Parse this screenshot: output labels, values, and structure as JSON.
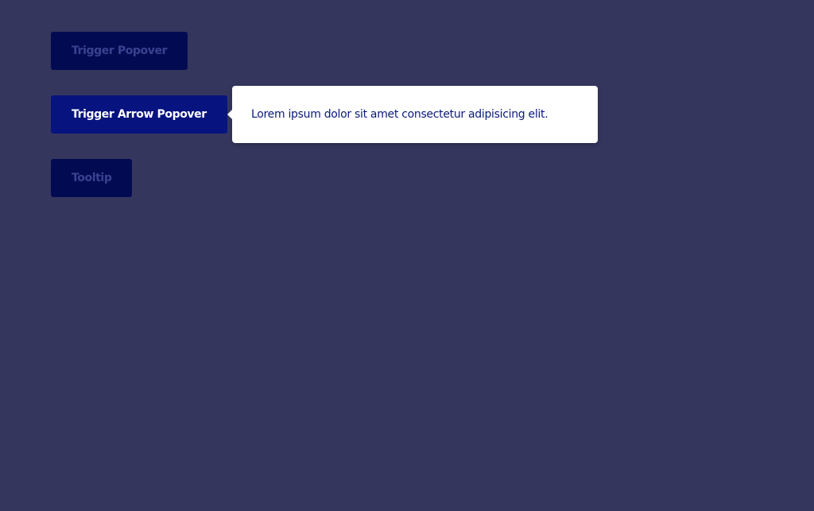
{
  "colors": {
    "background": "#34365e",
    "button_dim_bg": "#020b52",
    "button_dim_text": "#3a4190",
    "button_active_bg": "#07137f",
    "button_active_text": "#ffffff",
    "popover_bg": "#ffffff",
    "popover_text": "#0a1a7a"
  },
  "buttons": {
    "trigger_popover": "Trigger Popover",
    "trigger_arrow_popover": "Trigger Arrow Popover",
    "tooltip": "Tooltip"
  },
  "popover": {
    "text": "Lorem ipsum dolor sit amet consectetur adipisicing elit."
  }
}
